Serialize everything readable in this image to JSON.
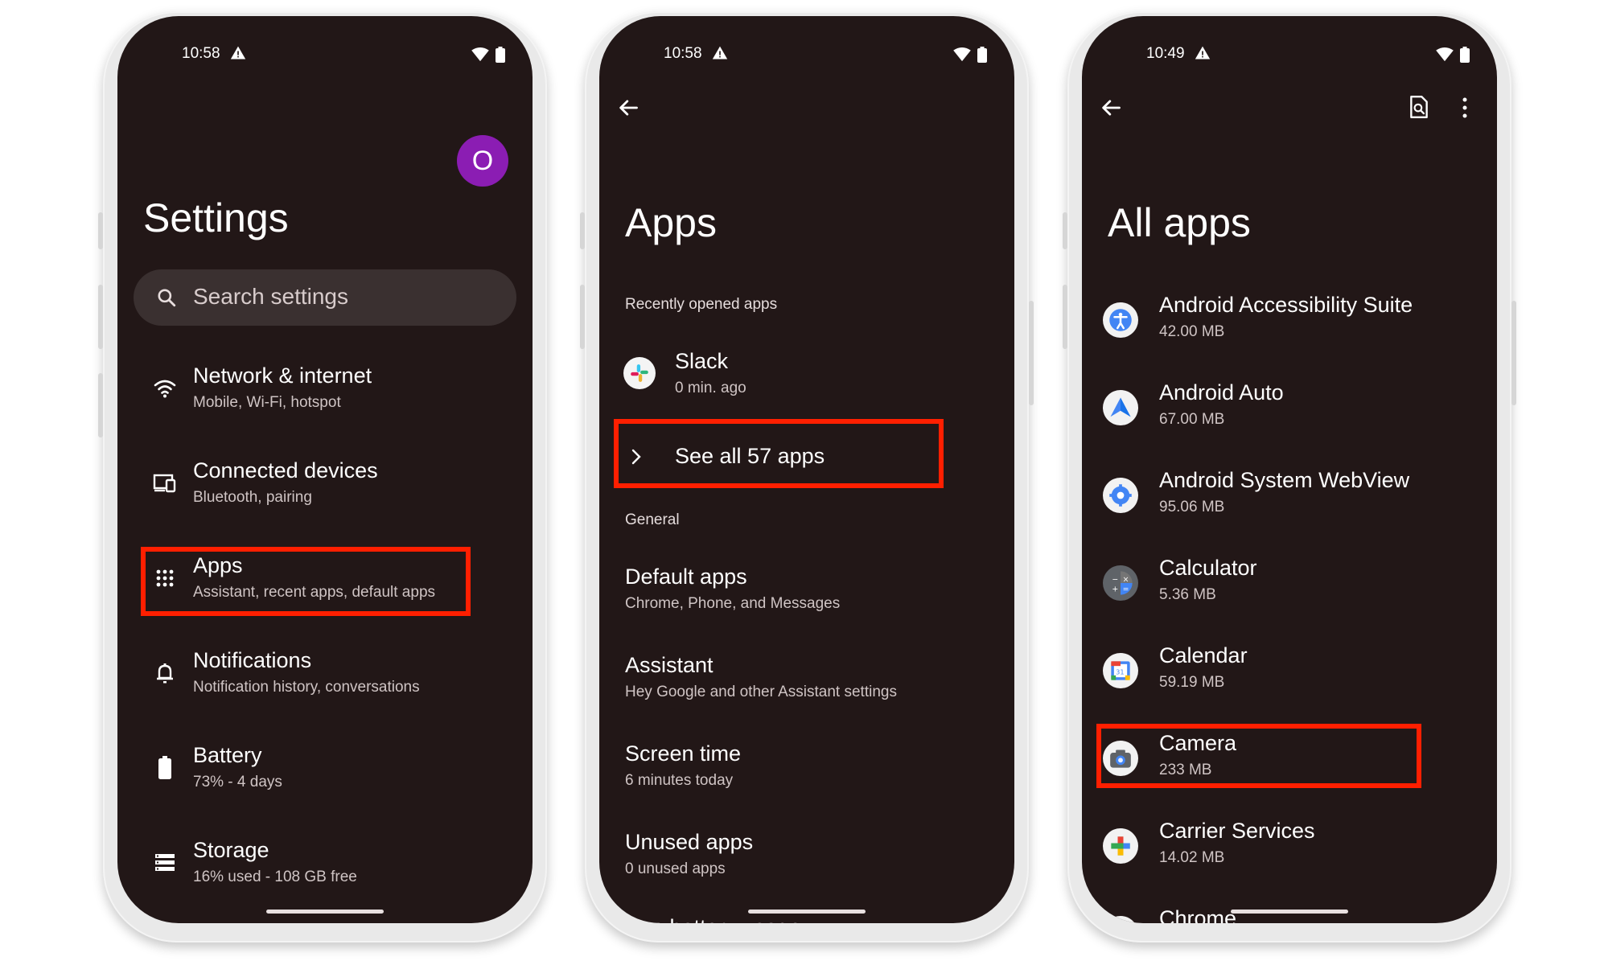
{
  "settings_screen": {
    "status_time": "10:58",
    "avatar_letter": "O",
    "title": "Settings",
    "search_placeholder": "Search settings",
    "items": [
      {
        "title": "Network & internet",
        "subtitle": "Mobile, Wi-Fi, hotspot",
        "icon": "wifi-icon"
      },
      {
        "title": "Connected devices",
        "subtitle": "Bluetooth, pairing",
        "icon": "devices-icon"
      },
      {
        "title": "Apps",
        "subtitle": "Assistant, recent apps, default apps",
        "icon": "apps-grid-icon"
      },
      {
        "title": "Notifications",
        "subtitle": "Notification history, conversations",
        "icon": "bell-icon"
      },
      {
        "title": "Battery",
        "subtitle": "73% - 4 days",
        "icon": "battery-icon"
      },
      {
        "title": "Storage",
        "subtitle": "16% used - 108 GB free",
        "icon": "storage-icon"
      }
    ]
  },
  "apps_screen": {
    "status_time": "10:58",
    "title": "Apps",
    "recent_header": "Recently opened apps",
    "recent_app": {
      "title": "Slack",
      "subtitle": "0 min. ago"
    },
    "see_all": "See all 57 apps",
    "general_header": "General",
    "items": [
      {
        "title": "Default apps",
        "subtitle": "Chrome, Phone, and Messages"
      },
      {
        "title": "Assistant",
        "subtitle": "Hey Google and other Assistant settings"
      },
      {
        "title": "Screen time",
        "subtitle": "6 minutes today"
      },
      {
        "title": "Unused apps",
        "subtitle": "0 unused apps"
      },
      {
        "title": "App battery usage",
        "subtitle": ""
      }
    ]
  },
  "all_apps_screen": {
    "status_time": "10:49",
    "title": "All apps",
    "apps": [
      {
        "name": "Android Accessibility Suite",
        "size": "42.00 MB",
        "icon": "accessibility-icon"
      },
      {
        "name": "Android Auto",
        "size": "67.00 MB",
        "icon": "android-auto-icon"
      },
      {
        "name": "Android System WebView",
        "size": "95.06 MB",
        "icon": "webview-gear-icon"
      },
      {
        "name": "Calculator",
        "size": "5.36 MB",
        "icon": "calculator-icon"
      },
      {
        "name": "Calendar",
        "size": "59.19 MB",
        "icon": "calendar-icon"
      },
      {
        "name": "Camera",
        "size": "233 MB",
        "icon": "camera-icon"
      },
      {
        "name": "Carrier Services",
        "size": "14.02 MB",
        "icon": "carrier-services-icon"
      },
      {
        "name": "Chrome",
        "size": "",
        "icon": "chrome-icon"
      }
    ]
  },
  "colors": {
    "screen_bg": "#221717",
    "highlight": "#ff1f00",
    "avatar": "#8b1db3"
  }
}
